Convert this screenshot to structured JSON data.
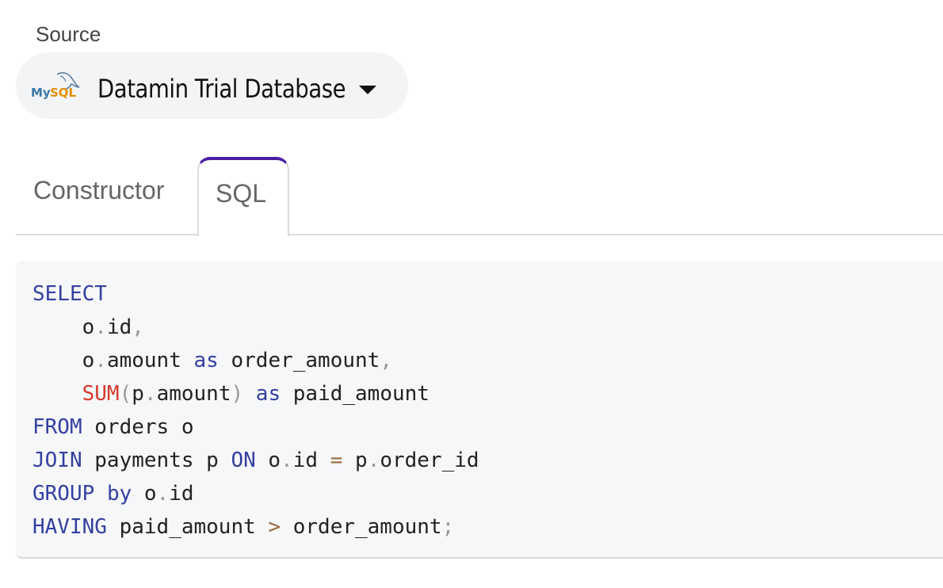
{
  "source": {
    "label": "Source",
    "selected": "Datamin Trial Database",
    "logo_text": "MySQL"
  },
  "tabs": [
    {
      "label": "Constructor",
      "active": false
    },
    {
      "label": "SQL",
      "active": true
    }
  ],
  "colors": {
    "active_tab_accent": "#4a1fa3",
    "keyword": "#3340a0",
    "function": "#d63a2e",
    "punctuation": "#999999",
    "operator": "#9a6a3a"
  },
  "sql": {
    "lines": [
      [
        {
          "t": "SELECT",
          "c": "kw"
        }
      ],
      [
        {
          "t": "    o",
          "c": "id"
        },
        {
          "t": ".",
          "c": "pn"
        },
        {
          "t": "id",
          "c": "id"
        },
        {
          "t": ",",
          "c": "pn"
        }
      ],
      [
        {
          "t": "    o",
          "c": "id"
        },
        {
          "t": ".",
          "c": "pn"
        },
        {
          "t": "amount ",
          "c": "id"
        },
        {
          "t": "as",
          "c": "kw"
        },
        {
          "t": " order_amount",
          "c": "id"
        },
        {
          "t": ",",
          "c": "pn"
        }
      ],
      [
        {
          "t": "    ",
          "c": "id"
        },
        {
          "t": "SUM",
          "c": "fn"
        },
        {
          "t": "(",
          "c": "pn"
        },
        {
          "t": "p",
          "c": "id"
        },
        {
          "t": ".",
          "c": "pn"
        },
        {
          "t": "amount",
          "c": "id"
        },
        {
          "t": ")",
          "c": "pn"
        },
        {
          "t": " ",
          "c": "id"
        },
        {
          "t": "as",
          "c": "kw"
        },
        {
          "t": " paid_amount",
          "c": "id"
        }
      ],
      [
        {
          "t": "FROM",
          "c": "kw"
        },
        {
          "t": " orders o",
          "c": "id"
        }
      ],
      [
        {
          "t": "JOIN",
          "c": "kw"
        },
        {
          "t": " payments p ",
          "c": "id"
        },
        {
          "t": "ON",
          "c": "kw"
        },
        {
          "t": " o",
          "c": "id"
        },
        {
          "t": ".",
          "c": "pn"
        },
        {
          "t": "id ",
          "c": "id"
        },
        {
          "t": "=",
          "c": "op"
        },
        {
          "t": " p",
          "c": "id"
        },
        {
          "t": ".",
          "c": "pn"
        },
        {
          "t": "order_id",
          "c": "id"
        }
      ],
      [
        {
          "t": "GROUP",
          "c": "kw"
        },
        {
          "t": " ",
          "c": "id"
        },
        {
          "t": "by",
          "c": "kw"
        },
        {
          "t": " o",
          "c": "id"
        },
        {
          "t": ".",
          "c": "pn"
        },
        {
          "t": "id",
          "c": "id"
        }
      ],
      [
        {
          "t": "HAVING",
          "c": "kw"
        },
        {
          "t": " paid_amount ",
          "c": "id"
        },
        {
          "t": ">",
          "c": "op"
        },
        {
          "t": " order_amount",
          "c": "id"
        },
        {
          "t": ";",
          "c": "pn"
        }
      ]
    ]
  }
}
